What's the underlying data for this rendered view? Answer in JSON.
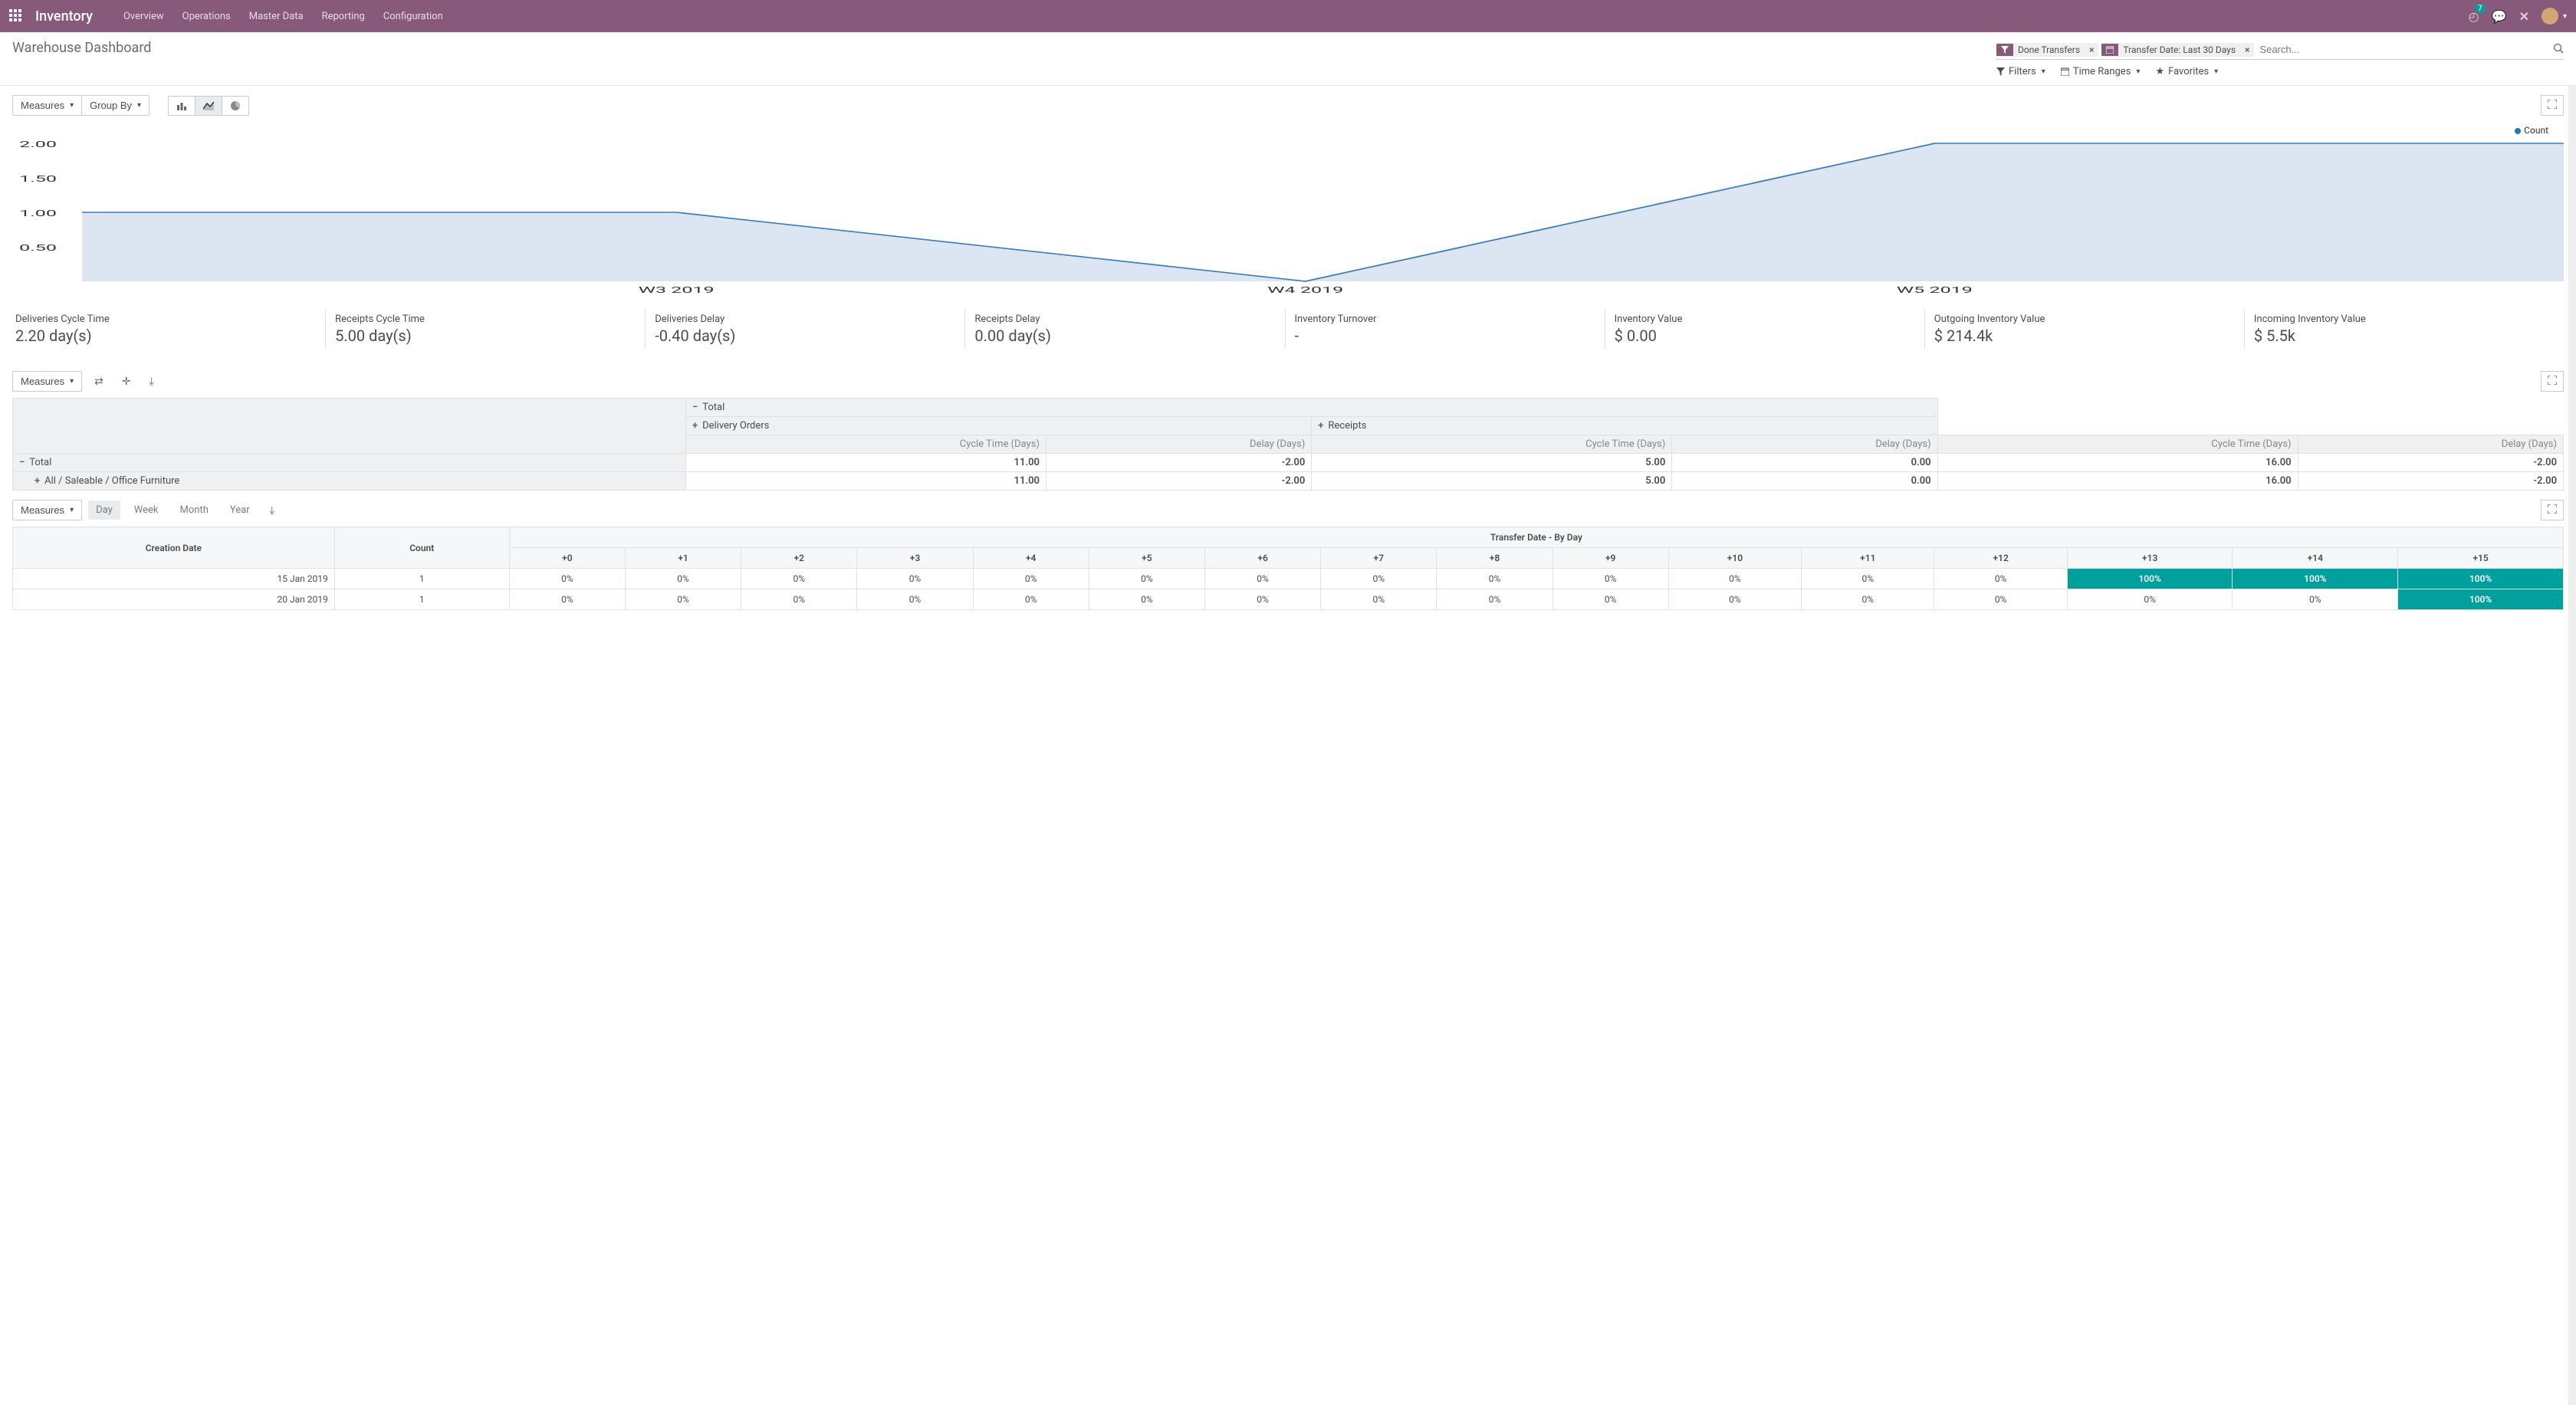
{
  "nav": {
    "brand": "Inventory",
    "items": [
      "Overview",
      "Operations",
      "Master Data",
      "Reporting",
      "Configuration"
    ],
    "badge": "7"
  },
  "header": {
    "title": "Warehouse Dashboard",
    "facets": {
      "a_label": "Done Transfers",
      "b_label": "Transfer Date: Last 30 Days"
    },
    "search_placeholder": "Search...",
    "filters_label": "Filters",
    "timeranges_label": "Time Ranges",
    "favorites_label": "Favorites"
  },
  "graph_toolbar": {
    "measures": "Measures",
    "groupby": "Group By"
  },
  "chart_data": {
    "type": "area",
    "categories": [
      "W3 2019",
      "W4 2019",
      "W5 2019"
    ],
    "values": [
      1,
      0,
      2
    ],
    "legend": "Count",
    "ylim": [
      0,
      2
    ],
    "yticks": [
      "0.50",
      "1.00",
      "1.50",
      "2.00"
    ]
  },
  "metrics": [
    {
      "label": "Deliveries Cycle Time",
      "value": "2.20 day(s)"
    },
    {
      "label": "Receipts Cycle Time",
      "value": "5.00 day(s)"
    },
    {
      "label": "Deliveries Delay",
      "value": "-0.40 day(s)"
    },
    {
      "label": "Receipts Delay",
      "value": "0.00 day(s)"
    },
    {
      "label": "Inventory Turnover",
      "value": "-"
    },
    {
      "label": "Inventory Value",
      "value": "$ 0.00"
    },
    {
      "label": "Outgoing Inventory Value",
      "value": "$ 214.4k"
    },
    {
      "label": "Incoming Inventory Value",
      "value": "$ 5.5k"
    }
  ],
  "pivot": {
    "measures": "Measures",
    "col_groups": {
      "total": "Total",
      "delivery": "Delivery Orders",
      "receipts": "Receipts"
    },
    "col_measures": {
      "cycle": "Cycle Time (Days)",
      "delay": "Delay (Days)"
    },
    "rows": [
      {
        "label": "Total",
        "expand": "−",
        "indent": 0,
        "vals": [
          "11.00",
          "-2.00",
          "5.00",
          "0.00",
          "16.00",
          "-2.00"
        ]
      },
      {
        "label": "All / Saleable / Office Furniture",
        "expand": "+",
        "indent": 1,
        "vals": [
          "11.00",
          "-2.00",
          "5.00",
          "0.00",
          "16.00",
          "-2.00"
        ]
      }
    ]
  },
  "cohort": {
    "measures": "Measures",
    "periods": {
      "day": "Day",
      "week": "Week",
      "month": "Month",
      "year": "Year"
    },
    "header_main": "Transfer Date - By Day",
    "col_date": "Creation Date",
    "col_count": "Count",
    "offsets": [
      "+0",
      "+1",
      "+2",
      "+3",
      "+4",
      "+5",
      "+6",
      "+7",
      "+8",
      "+9",
      "+10",
      "+11",
      "+12",
      "+13",
      "+14",
      "+15"
    ],
    "rows": [
      {
        "date": "15 Jan 2019",
        "count": "1",
        "cells": [
          "0%",
          "0%",
          "0%",
          "0%",
          "0%",
          "0%",
          "0%",
          "0%",
          "0%",
          "0%",
          "0%",
          "0%",
          "0%",
          "100%",
          "100%",
          "100%"
        ]
      },
      {
        "date": "20 Jan 2019",
        "count": "1",
        "cells": [
          "0%",
          "0%",
          "0%",
          "0%",
          "0%",
          "0%",
          "0%",
          "0%",
          "0%",
          "0%",
          "0%",
          "0%",
          "0%",
          "0%",
          "0%",
          "100%"
        ]
      }
    ]
  }
}
